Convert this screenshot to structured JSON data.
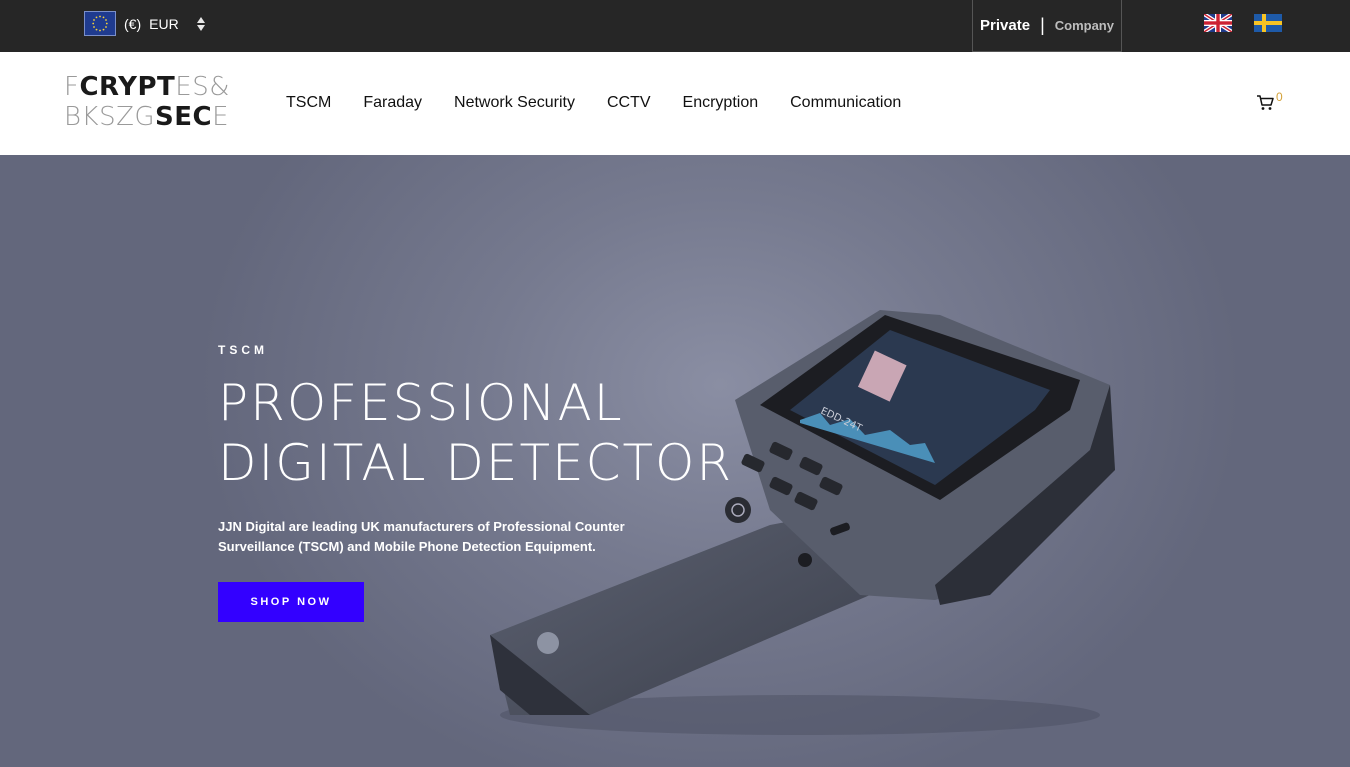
{
  "topbar": {
    "currency": {
      "flag_icon": "eu-flag-icon",
      "symbol": "(€)",
      "code": "EUR",
      "arrows_icon": "sort-arrows-icon"
    },
    "segment": {
      "private_label": "Private",
      "separator": "|",
      "company_label": "Company"
    },
    "languages": [
      {
        "icon": "uk-flag-icon"
      },
      {
        "icon": "sweden-flag-icon"
      }
    ]
  },
  "header": {
    "logo": {
      "line1_light_a": "F",
      "line1_bold": "CRYPT",
      "line1_light_b": "ES&",
      "line2_light": "BKSZG",
      "line2_bold": "SEC",
      "line2_light_b": "E"
    },
    "nav": [
      {
        "label": "TSCM"
      },
      {
        "label": "Faraday"
      },
      {
        "label": "Network Security"
      },
      {
        "label": "CCTV"
      },
      {
        "label": "Encryption"
      },
      {
        "label": "Communication"
      }
    ],
    "cart": {
      "icon": "cart-icon",
      "count": "0"
    }
  },
  "hero": {
    "eyebrow": "TSCM",
    "title_line1": "PROFESSIONAL",
    "title_line2": "DIGITAL DETECTOR",
    "description": "JJN Digital are leading UK manufacturers of Professional Counter Surveillance (TSCM) and Mobile Phone Detection Equipment.",
    "button_label": "SHOP NOW",
    "device_model": "EDD-24T"
  },
  "colors": {
    "topbar_bg": "#262626",
    "accent": "#3300ff",
    "cart_count": "#d4a23a"
  }
}
